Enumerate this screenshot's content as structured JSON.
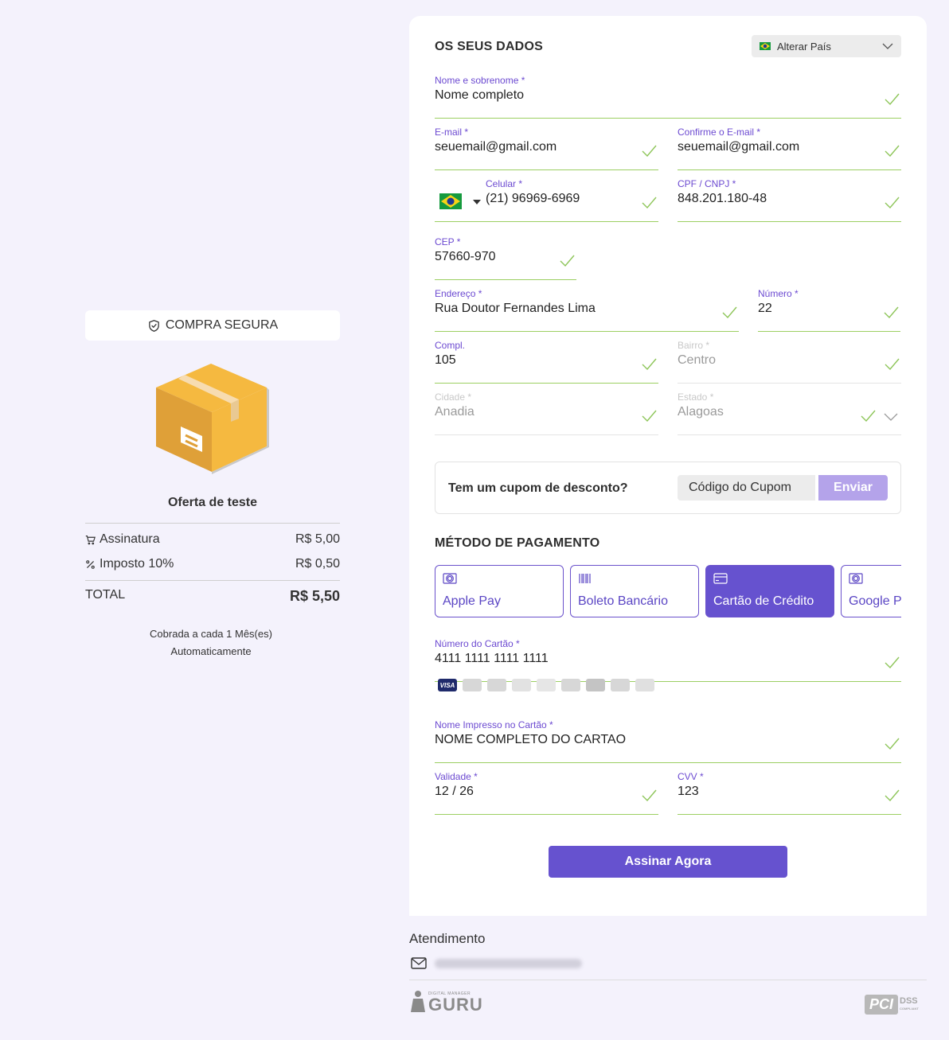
{
  "summary": {
    "secure_label": "COMPRA SEGURA",
    "offer_name": "Oferta de teste",
    "items": [
      {
        "label": "Assinatura",
        "icon": "cart-icon",
        "price": "R$ 5,00"
      },
      {
        "label": "Imposto 10%",
        "icon": "percent-icon",
        "price": "R$ 0,50"
      }
    ],
    "total_label": "TOTAL",
    "total_value": "R$ 5,50",
    "billing_line1": "Cobrada a cada 1 Mês(es)",
    "billing_line2": "Automaticamente"
  },
  "form": {
    "title": "OS SEUS DADOS",
    "country_label": "Alterar País",
    "name": {
      "label": "Nome e sobrenome *",
      "value": "Nome completo"
    },
    "email": {
      "label": "E-mail *",
      "value": "seuemail@gmail.com"
    },
    "email_confirm": {
      "label": "Confirme o E-mail *",
      "value": "seuemail@gmail.com"
    },
    "phone": {
      "label": "Celular *",
      "value": "(21) 96969-6969"
    },
    "cpf": {
      "label": "CPF / CNPJ *",
      "value": "848.201.180-48"
    },
    "cep": {
      "label": "CEP *",
      "value": "57660-970"
    },
    "address": {
      "label": "Endereço *",
      "value": "Rua Doutor Fernandes Lima"
    },
    "number": {
      "label": "Número *",
      "value": "22"
    },
    "complement": {
      "label": "Compl.",
      "value": "105"
    },
    "district": {
      "label": "Bairro *",
      "value": "Centro"
    },
    "city": {
      "label": "Cidade *",
      "value": "Anadia"
    },
    "state": {
      "label": "Estado *",
      "value": "Alagoas"
    }
  },
  "coupon": {
    "question": "Tem um cupom de desconto?",
    "placeholder": "Código do Cupom",
    "button": "Enviar"
  },
  "payment": {
    "title": "MÉTODO DE PAGAMENTO",
    "methods": [
      {
        "label": "Apple Pay",
        "icon": "cash-icon",
        "active": false
      },
      {
        "label": "Boleto Bancário",
        "icon": "barcode-icon",
        "active": false
      },
      {
        "label": "Cartão de Crédito",
        "icon": "credit-card-icon",
        "active": true
      },
      {
        "label": "Google Pay",
        "icon": "cash-icon",
        "active": false
      }
    ],
    "card_number": {
      "label": "Número do Cartão *",
      "value": "4111 1111 1111 1111"
    },
    "brand_visa": "VISA",
    "card_name": {
      "label": "Nome Impresso no Cartão *",
      "value": "NOME COMPLETO DO CARTAO"
    },
    "expiry": {
      "label": "Validade *",
      "value": "12 / 26"
    },
    "cvv": {
      "label": "CVV *",
      "value": "123"
    },
    "submit": "Assinar Agora"
  },
  "footer": {
    "support_title": "Atendimento",
    "guru_small": "DIGITAL MANAGER",
    "guru_big": "GURU",
    "pci": "PCI",
    "dss": "DSS",
    "compliant": "COMPLIANT"
  },
  "colors": {
    "accent": "#6652cf",
    "valid": "#9ccf62",
    "background": "#f4f2fc"
  }
}
